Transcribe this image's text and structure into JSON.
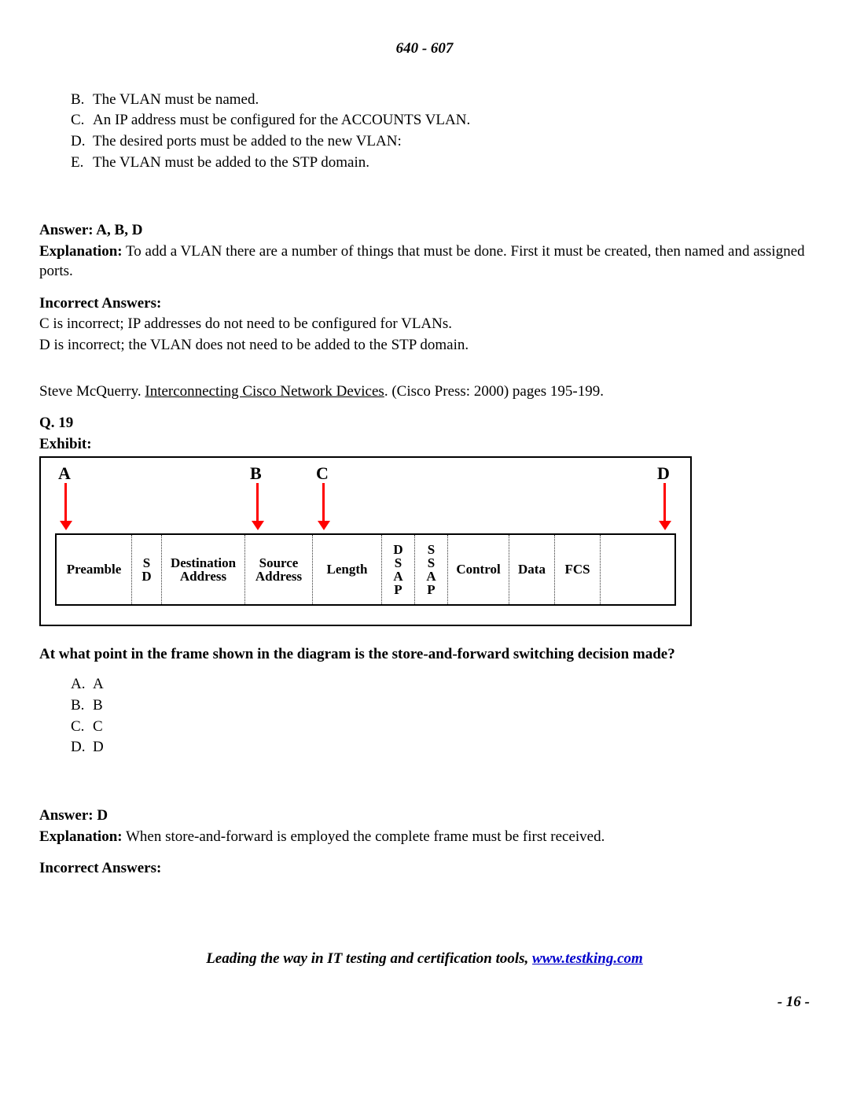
{
  "header": "640 - 607",
  "top_options": [
    {
      "letter": "B.",
      "text": "The VLAN must be named."
    },
    {
      "letter": "C.",
      "text": "An IP address must be configured for the ACCOUNTS VLAN."
    },
    {
      "letter": "D.",
      "text": "The desired ports must be added to the new VLAN:"
    },
    {
      "letter": "E.",
      "text": "The VLAN must be added to the STP domain."
    }
  ],
  "answer1_label": "Answer: A, B, D",
  "explanation1_label": "Explanation:",
  "explanation1_text": " To add a VLAN there are a number of things that must be done.  First it must be created, then named and assigned ports.",
  "incorrect1_label": "Incorrect Answers:",
  "incorrect1_lines": [
    "C is incorrect; IP addresses do not need to be configured for VLANs.",
    "D is incorrect; the VLAN does not need to be added to the STP domain."
  ],
  "reference_pre": "Steve McQuerry.  ",
  "reference_title": "Interconnecting Cisco Network Devices",
  "reference_post": ". (Cisco Press: 2000) pages 195-199.",
  "q19_label": "Q. 19",
  "exhibit_label": "Exhibit:",
  "arrows": {
    "A": "A",
    "B": "B",
    "C": "C",
    "D": "D"
  },
  "frame_cells": {
    "preamble": "Preamble",
    "sd": "S\nD",
    "dest": "Destination\nAddress",
    "src": "Source\nAddress",
    "length": "Length",
    "dsap": "D\nS\nA\nP",
    "ssap": "S\nS\nA\nP",
    "control": "Control",
    "data": "Data",
    "fcs": "FCS"
  },
  "q19_text": "At what point in the frame shown in the diagram is the store-and-forward switching decision made?",
  "q19_options": [
    {
      "letter": "A.",
      "text": "A"
    },
    {
      "letter": "B.",
      "text": "B"
    },
    {
      "letter": "C.",
      "text": "C"
    },
    {
      "letter": "D.",
      "text": "D"
    }
  ],
  "answer2_label": "Answer: D",
  "explanation2_label": "Explanation:",
  "explanation2_text": " When store-and-forward is employed the complete frame must be first received.",
  "incorrect2_label": "Incorrect Answers:",
  "footer_text": "Leading the way in IT testing and certification tools, ",
  "footer_link": "www.testking.com",
  "page_number": "- 16 -"
}
